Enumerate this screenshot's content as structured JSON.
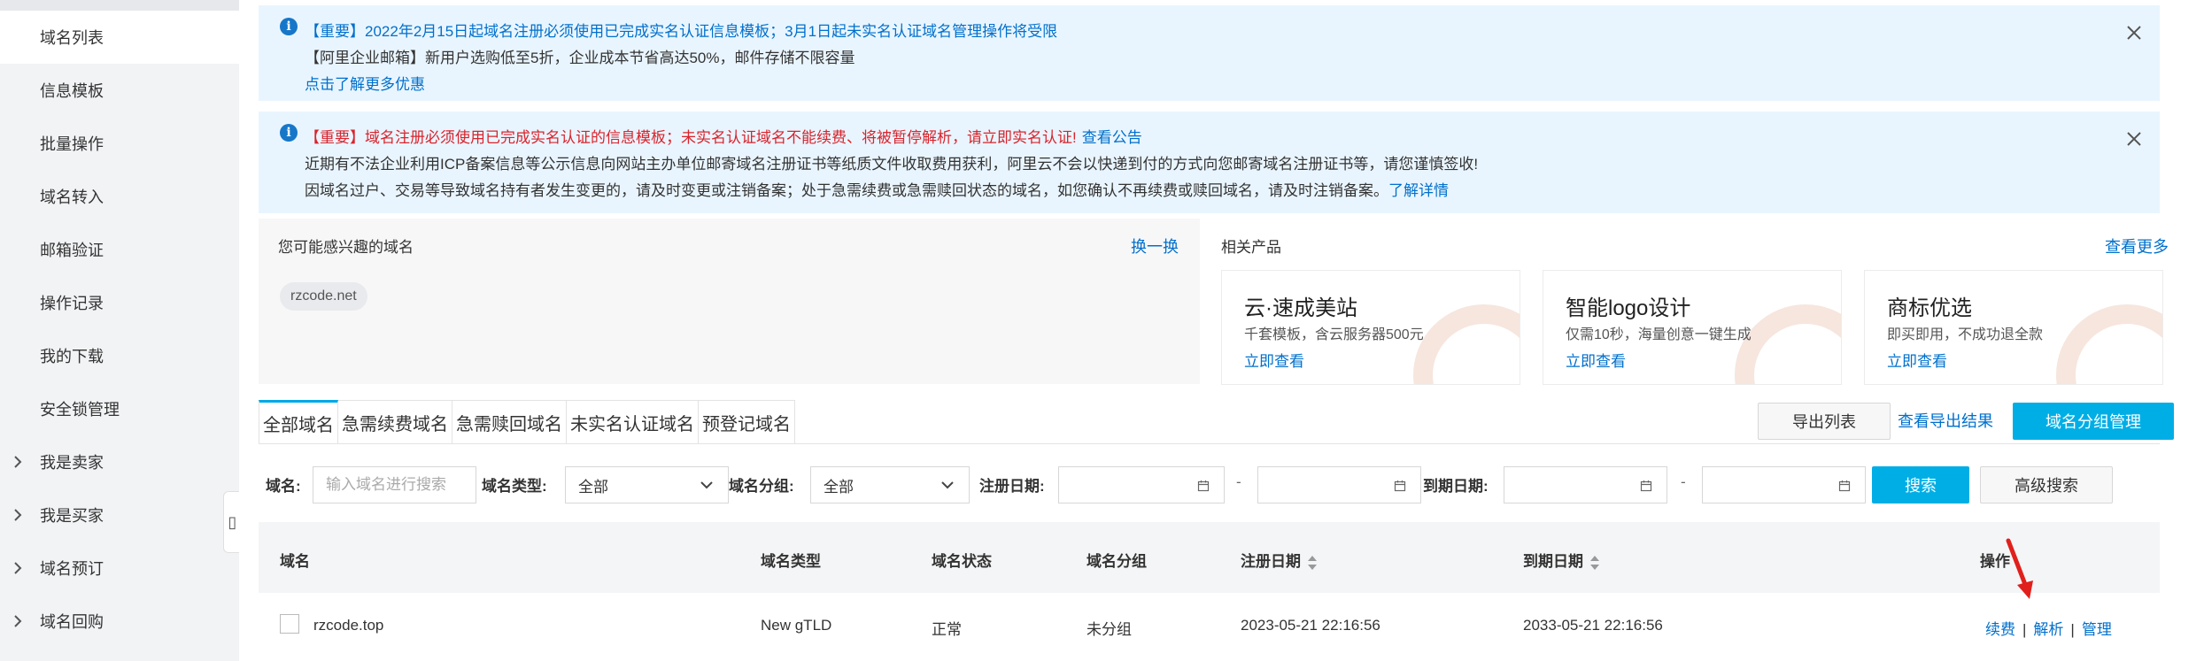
{
  "sidebar": {
    "items": [
      {
        "label": "域名列表",
        "active": true,
        "expandable": false
      },
      {
        "label": "信息模板",
        "active": false,
        "expandable": false
      },
      {
        "label": "批量操作",
        "active": false,
        "expandable": false
      },
      {
        "label": "域名转入",
        "active": false,
        "expandable": false
      },
      {
        "label": "邮箱验证",
        "active": false,
        "expandable": false
      },
      {
        "label": "操作记录",
        "active": false,
        "expandable": false
      },
      {
        "label": "我的下载",
        "active": false,
        "expandable": false
      },
      {
        "label": "安全锁管理",
        "active": false,
        "expandable": false
      },
      {
        "label": "我是卖家",
        "active": false,
        "expandable": true
      },
      {
        "label": "我是买家",
        "active": false,
        "expandable": true
      },
      {
        "label": "域名预订",
        "active": false,
        "expandable": true
      },
      {
        "label": "域名回购",
        "active": false,
        "expandable": true
      }
    ],
    "collapse_glyph": "▯"
  },
  "notices": [
    {
      "line1": "【重要】2022年2月15日起域名注册必须使用已完成实名认证信息模板；3月1日起未实名认证域名管理操作将受限",
      "line2": "【阿里企业邮箱】新用户选购低至5折，企业成本节省高达50%，邮件存储不限容量",
      "line3": "点击了解更多优惠"
    },
    {
      "line1": "【重要】域名注册必须使用已完成实名认证的信息模板；未实名认证域名不能续费、将被暂停解析，请立即实名认证!",
      "line1_link": "查看公告",
      "line2": "近期有不法企业利用ICP备案信息等公示信息向网站主办单位邮寄域名注册证书等纸质文件收取费用获利，阿里云不会以快递到付的方式向您邮寄域名注册证书等，请您谨慎签收!",
      "line3": "因域名过户、交易等导致域名持有者发生变更的，请及时变更或注销备案；处于急需续费或急需赎回状态的域名，如您确认不再续费或赎回域名，请及时注销备案。",
      "line3_link": "了解详情"
    }
  ],
  "interest": {
    "title": "您可能感兴趣的域名",
    "swap": "换一换",
    "chip": "rzcode.net"
  },
  "related": {
    "title": "相关产品",
    "more": "查看更多",
    "cards": [
      {
        "title": "云·速成美站",
        "desc": "千套模板，含云服务器500元",
        "link": "立即查看"
      },
      {
        "title": "智能logo设计",
        "desc": "仅需10秒，海量创意一键生成",
        "link": "立即查看"
      },
      {
        "title": "商标优选",
        "desc": "即买即用，不成功退全款",
        "link": "立即查看"
      }
    ]
  },
  "tabs": [
    "全部域名",
    "急需续费域名",
    "急需赎回域名",
    "未实名认证域名",
    "预登记域名"
  ],
  "actions": {
    "export": "导出列表",
    "view_export": "查看导出结果",
    "group_manage": "域名分组管理"
  },
  "filters": {
    "domain_label": "域名:",
    "domain_placeholder": "输入域名进行搜索",
    "type_label": "域名类型:",
    "type_value": "全部",
    "group_label": "域名分组:",
    "group_value": "全部",
    "reg_label": "注册日期:",
    "exp_label": "到期日期:",
    "dash": "-",
    "search": "搜索",
    "advanced": "高级搜索"
  },
  "table": {
    "headers": {
      "domain": "域名",
      "type": "域名类型",
      "status": "域名状态",
      "group": "域名分组",
      "reg_date": "注册日期",
      "exp_date": "到期日期",
      "ops": "操作"
    },
    "rows": [
      {
        "domain": "rzcode.top",
        "type": "New gTLD",
        "status": "正常",
        "group": "未分组",
        "reg_date": "2023-05-21 22:16:56",
        "exp_date": "2033-05-21 22:16:56",
        "op_renew": "续费",
        "op_resolve": "解析",
        "op_manage": "管理",
        "sep": "|"
      }
    ]
  },
  "colors": {
    "accent": "#00aee6",
    "link": "#0070cc",
    "alert_red": "#d9232c",
    "notice_bg": "#e9f5fe",
    "arrow": "#e0201c"
  }
}
